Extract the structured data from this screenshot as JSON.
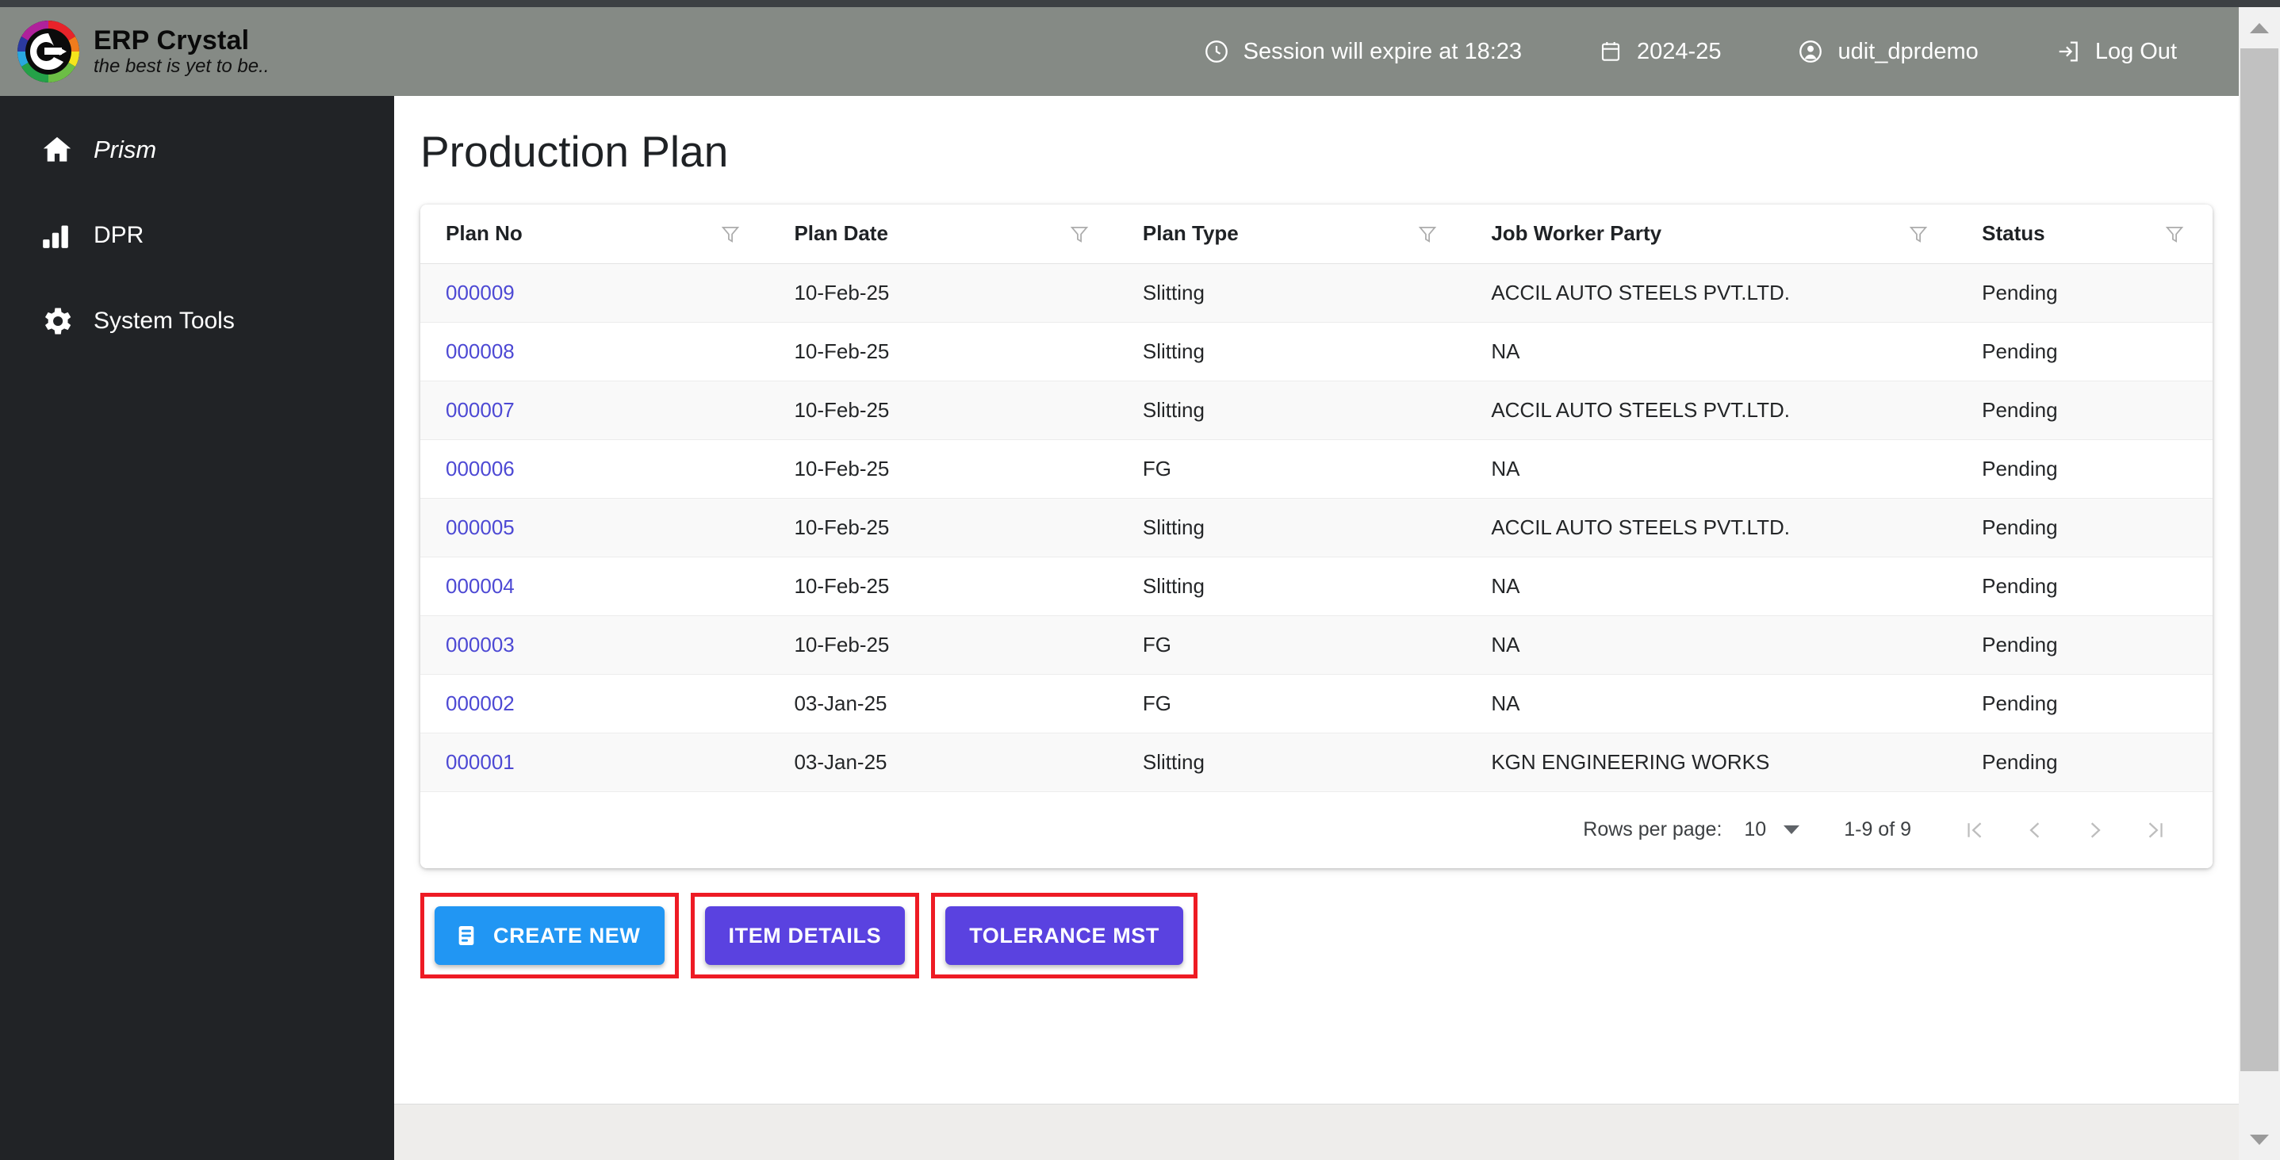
{
  "header": {
    "brand_title": "ERP Crystal",
    "brand_tagline": "the best is yet to be..",
    "session": "Session will expire at 18:23",
    "fiscal_year": "2024-25",
    "username": "udit_dprdemo",
    "logout": "Log Out"
  },
  "sidebar": {
    "items": [
      {
        "label": "Prism",
        "icon": "home-icon"
      },
      {
        "label": "DPR",
        "icon": "bar-chart-icon"
      },
      {
        "label": "System Tools",
        "icon": "gear-icon"
      }
    ]
  },
  "main": {
    "page_title": "Production Plan",
    "table": {
      "columns": [
        {
          "label": "Plan No"
        },
        {
          "label": "Plan Date"
        },
        {
          "label": "Plan Type"
        },
        {
          "label": "Job Worker Party"
        },
        {
          "label": "Status"
        }
      ],
      "rows": [
        {
          "plan_no": "000009",
          "plan_date": "10-Feb-25",
          "plan_type": "Slitting",
          "job_worker_party": "ACCIL AUTO STEELS PVT.LTD.",
          "status": "Pending"
        },
        {
          "plan_no": "000008",
          "plan_date": "10-Feb-25",
          "plan_type": "Slitting",
          "job_worker_party": "NA",
          "status": "Pending"
        },
        {
          "plan_no": "000007",
          "plan_date": "10-Feb-25",
          "plan_type": "Slitting",
          "job_worker_party": "ACCIL AUTO STEELS PVT.LTD.",
          "status": "Pending"
        },
        {
          "plan_no": "000006",
          "plan_date": "10-Feb-25",
          "plan_type": "FG",
          "job_worker_party": "NA",
          "status": "Pending"
        },
        {
          "plan_no": "000005",
          "plan_date": "10-Feb-25",
          "plan_type": "Slitting",
          "job_worker_party": "ACCIL AUTO STEELS PVT.LTD.",
          "status": "Pending"
        },
        {
          "plan_no": "000004",
          "plan_date": "10-Feb-25",
          "plan_type": "Slitting",
          "job_worker_party": "NA",
          "status": "Pending"
        },
        {
          "plan_no": "000003",
          "plan_date": "10-Feb-25",
          "plan_type": "FG",
          "job_worker_party": "NA",
          "status": "Pending"
        },
        {
          "plan_no": "000002",
          "plan_date": "03-Jan-25",
          "plan_type": "FG",
          "job_worker_party": "NA",
          "status": "Pending"
        },
        {
          "plan_no": "000001",
          "plan_date": "03-Jan-25",
          "plan_type": "Slitting",
          "job_worker_party": "KGN ENGINEERING WORKS",
          "status": "Pending"
        }
      ]
    },
    "paginator": {
      "rows_per_page_label": "Rows per page:",
      "rows_per_page_value": "10",
      "range": "1-9 of 9"
    },
    "actions": [
      {
        "label": "CREATE NEW",
        "style": "blue",
        "icon": "document-icon",
        "highlighted": true
      },
      {
        "label": "ITEM DETAILS",
        "style": "purple",
        "icon": "",
        "highlighted": true
      },
      {
        "label": "TOLERANCE MST",
        "style": "purple",
        "icon": "",
        "highlighted": true
      }
    ]
  },
  "colors": {
    "header_bg": "#858a85",
    "sidebar_bg": "#212326",
    "link": "#4d49d4",
    "primary_blue": "#2196f3",
    "primary_purple": "#5a42e0",
    "highlight_red": "#ee1b24"
  }
}
